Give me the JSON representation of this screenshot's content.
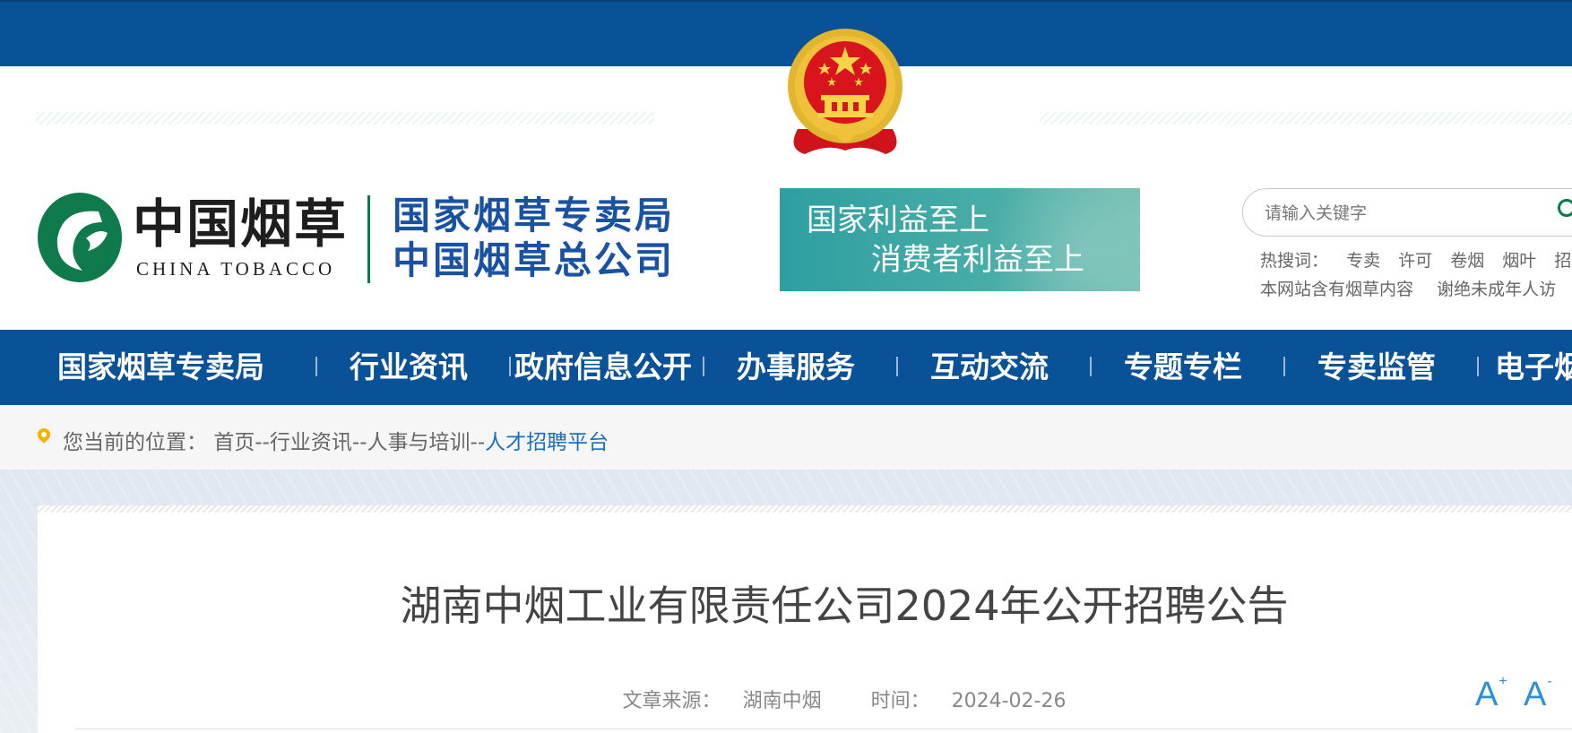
{
  "header": {
    "logo_cn": "中国烟草",
    "logo_en": "CHINA TOBACCO",
    "agency_line1": "国家烟草专卖局",
    "agency_line2": "中国烟草总公司",
    "slogan_line1": "国家利益至上",
    "slogan_line2": "消费者利益至上",
    "brand_color": "#0a5297"
  },
  "search": {
    "placeholder": "请输入关键字",
    "hot_label": "热搜词：",
    "hot_words": [
      "专卖",
      "许可",
      "卷烟",
      "烟叶",
      "招聘"
    ],
    "notice": [
      "本网站含有烟草内容",
      "谢绝未成年人访"
    ]
  },
  "nav": {
    "items": [
      "国家烟草专卖局",
      "行业资讯",
      "政府信息公开",
      "办事服务",
      "互动交流",
      "专题专栏",
      "专卖监管",
      "电子烟"
    ]
  },
  "breadcrumb": {
    "prefix": "您当前的位置：",
    "home": "首页",
    "sep": "--",
    "level1": "行业资讯",
    "level2": "人事与培训",
    "current": "人才招聘平台"
  },
  "article": {
    "title": "湖南中烟工业有限责任公司2024年公开招聘公告",
    "source_label": "文章来源：",
    "source": "湖南中烟",
    "time_label": "时间：",
    "time": "2024-02-26",
    "font_larger_label": "A",
    "font_smaller_label": "A",
    "font_larger_sup": "+",
    "font_smaller_sup": "-"
  }
}
